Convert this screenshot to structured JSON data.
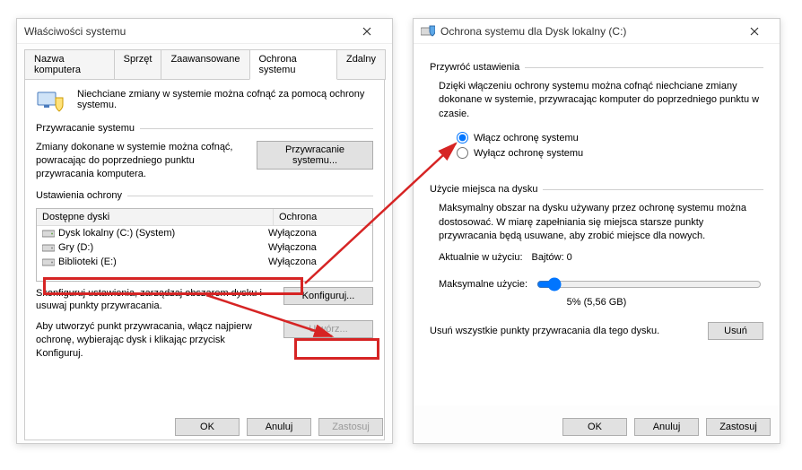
{
  "window1": {
    "title": "Właściwości systemu",
    "tabs": {
      "t1": "Nazwa komputera",
      "t2": "Sprzęt",
      "t3": "Zaawansowane",
      "t4": "Ochrona systemu",
      "t5": "Zdalny"
    },
    "info": "Niechciane zmiany w systemie można cofnąć za pomocą ochrony systemu.",
    "group_restore": "Przywracanie systemu",
    "restore_text": "Zmiany dokonane w systemie można cofnąć, powracając do poprzedniego punktu przywracania komputera.",
    "restore_btn": "Przywracanie systemu...",
    "group_settings": "Ustawienia ochrony",
    "table": {
      "col1": "Dostępne dyski",
      "col2": "Ochrona",
      "rows": [
        {
          "name": "Dysk lokalny (C:) (System)",
          "status": "Wyłączona"
        },
        {
          "name": "Gry (D:)",
          "status": "Wyłączona"
        },
        {
          "name": "Biblioteki (E:)",
          "status": "Wyłączona"
        }
      ]
    },
    "config_text": "Skonfiguruj ustawienia, zarządzaj obszarem dysku i usuwaj punkty przywracania.",
    "config_btn": "Konfiguruj...",
    "create_text": "Aby utworzyć punkt przywracania, włącz najpierw ochronę, wybierając dysk i klikając przycisk Konfiguruj.",
    "create_btn": "Utwórz...",
    "ok": "OK",
    "cancel": "Anuluj",
    "apply": "Zastosuj"
  },
  "window2": {
    "title": "Ochrona systemu dla Dysk lokalny (C:)",
    "group_restore": "Przywróć ustawienia",
    "restore_text": "Dzięki włączeniu ochrony systemu można cofnąć niechciane zmiany dokonane w systemie, przywracając komputer do poprzedniego punktu w czasie.",
    "radio_on": "Włącz ochronę systemu",
    "radio_off": "Wyłącz ochronę systemu",
    "group_usage": "Użycie miejsca na dysku",
    "usage_text": "Maksymalny obszar na dysku używany przez ochronę systemu można dostosować. W miarę zapełniania się miejsca starsze punkty przywracania będą usuwane, aby zrobić miejsce dla nowych.",
    "current_label": "Aktualnie w użyciu:",
    "current_value": "Bajtów: 0",
    "max_label": "Maksymalne użycie:",
    "slider_value": "5% (5,56 GB)",
    "delete_text": "Usuń wszystkie punkty przywracania dla tego dysku.",
    "delete_btn": "Usuń",
    "ok": "OK",
    "cancel": "Anuluj",
    "apply": "Zastosuj"
  }
}
